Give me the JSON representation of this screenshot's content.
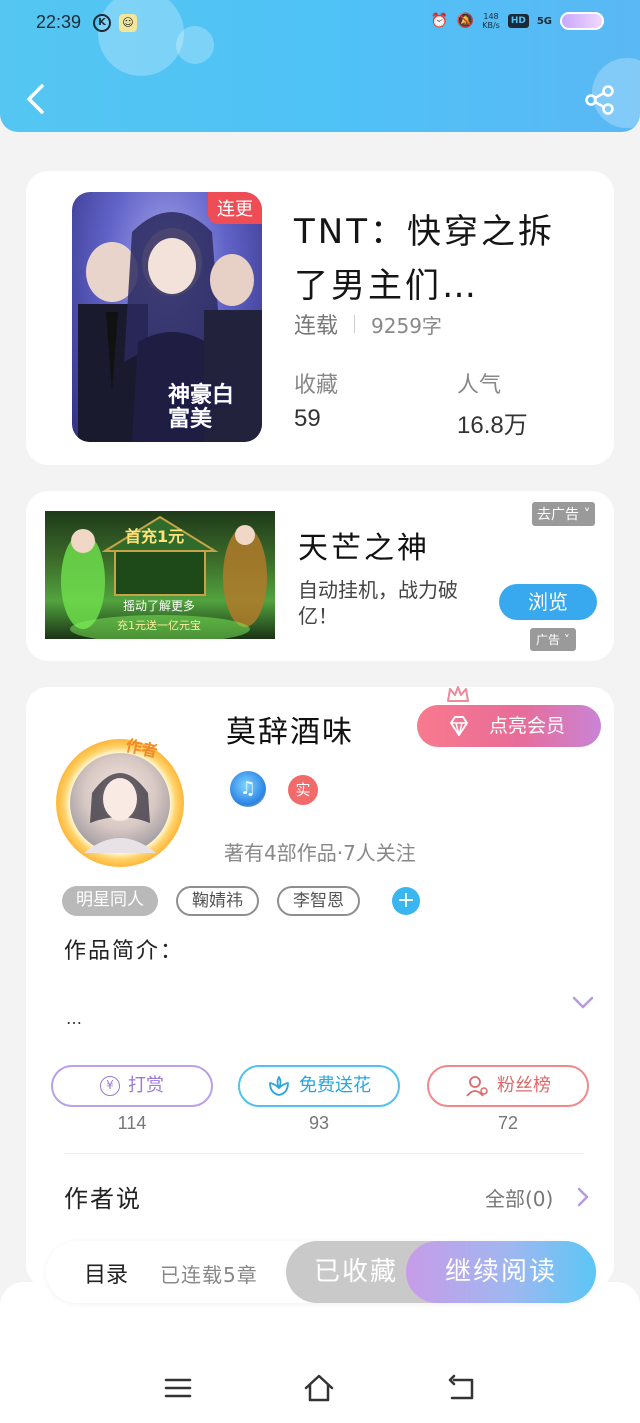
{
  "status_bar": {
    "time": "22:39",
    "k_icon_label": "K",
    "speed_value": "148",
    "speed_unit": "KB/s",
    "hd_label": "HD",
    "network_label": "5G"
  },
  "book": {
    "title": "TNT：快穿之拆了男主们…",
    "status": "连载",
    "word_count": "9259字",
    "cover_badge": "连更",
    "cover_text": "神豪白富美",
    "favorites_label": "收藏",
    "favorites_value": "59",
    "popularity_label": "人气",
    "popularity_value": "16.8万"
  },
  "ad": {
    "image_title": "首充1元",
    "image_mid": "摇动了解更多",
    "image_bottom": "充1元送一亿元宝",
    "title": "天芒之神",
    "description": "自动挂机，战力破亿！",
    "browse_button": "浏览",
    "close_label": "去广告",
    "ad_tag": "广告"
  },
  "author": {
    "avatar_tag": "作者",
    "name": "莫辞酒味",
    "vip_button": "点亮会员",
    "real_badge": "实",
    "meta": "著有4部作品·7人关注",
    "tags": [
      "明星同人",
      "鞠婧祎",
      "李智恩"
    ],
    "intro_label": "作品简介：",
    "intro_text": "…",
    "actions": {
      "reward_label": "打赏",
      "reward_count": "114",
      "flower_label": "免费送花",
      "flower_count": "93",
      "fans_label": "粉丝榜",
      "fans_count": "72"
    },
    "author_says_label": "作者说",
    "all_link": "全部(0)"
  },
  "action_bar": {
    "toc_label": "目录",
    "toc_count": "已连载5章",
    "favorited_label": "已收藏",
    "continue_label": "继续阅读"
  },
  "colors": {
    "header_blue": "#4fc2f6",
    "accent_blue": "#39a9ef",
    "badge_red": "#ee4d55",
    "vip_pink": "#f87a8e"
  }
}
